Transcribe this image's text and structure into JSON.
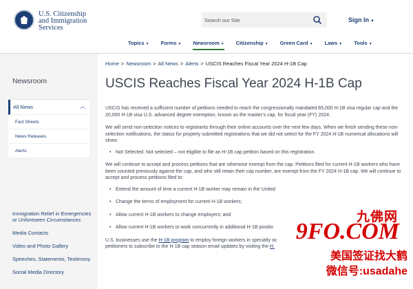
{
  "header": {
    "agency_line1": "U.S. Citizenship",
    "agency_line2": "and Immigration",
    "agency_line3": "Services",
    "search_placeholder": "Search our Site",
    "signin_label": "Sign In",
    "nav": [
      "Topics",
      "Forms",
      "Newsroom",
      "Citizenship",
      "Green Card",
      "Laws",
      "Tools"
    ],
    "active_nav": "Newsroom"
  },
  "sidebar": {
    "title": "Newsroom",
    "all_news": "All News",
    "sub_items": [
      "Fact Sheets",
      "News Releases",
      "Alerts"
    ],
    "links": [
      "Immigration Relief in Emergencies or Unforeseen Circumstances",
      "Media Contacts",
      "Video and Photo Gallery",
      "Speeches, Statements, Testimony",
      "Social Media Directory"
    ]
  },
  "breadcrumb": [
    "Home",
    "Newsroom",
    "All News",
    "Alerts",
    "USCIS Reaches Fiscal Year 2024 H-1B Cap"
  ],
  "page_title": "USCIS Reaches Fiscal Year 2024 H-1B Cap",
  "body": {
    "p1": "USCIS has received a sufficient number of petitions needed to reach the congressionally mandated 65,000 H-1B visa regular cap and the 20,000 H-1B visa U.S. advanced degree exemption, known as the master’s cap, for fiscal year (FY) 2024.",
    "p2": "We will send non-selection notices to registrants through their online accounts over the next few days. When we finish sending these non-selection notifications, the status for properly submitted registrations that we did not select for the FY 2024 H-1B numerical allocations will show:",
    "bullet1": "Not Selected: Not selected – not eligible to file an H-1B cap petition based on this registration.",
    "p3": "We will continue to accept and process petitions that are otherwise exempt from the cap. Petitions filed for current H-1B workers who have been counted previously against the cap, and who still retain their cap number, are exempt from the FY 2024 H-1B cap. We will continue to accept and process petitions filed to:",
    "bullets2": [
      "Extend the amount of time a current H-1B worker may remain in the United",
      "Change the terms of employment for current H-1B workers;",
      "Allow current H-1B workers to change employers; and",
      "Allow current H-1B workers to work concurrently in additional H-1B positio"
    ],
    "p4_start": "U.S. businesses use the ",
    "p4_link": "H-1B program",
    "p4_mid": " to employ foreign workers in specialty oc",
    "p4_line2": "petitioners to subscribe to the H-1B cap season email updates by visiting the ",
    "p4_link2": "H."
  },
  "watermark": {
    "cn_name": "九佛网",
    "logo": "9FO.COM",
    "line1": "美国签证找大鹤",
    "line2": "微信号:usadahe"
  }
}
